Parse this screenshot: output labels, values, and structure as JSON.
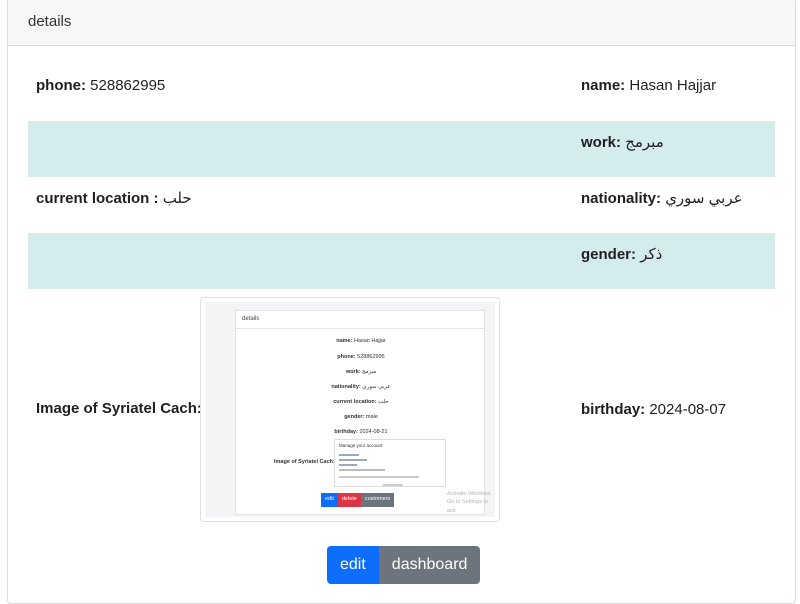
{
  "card": {
    "header": "details"
  },
  "fields": {
    "phone": {
      "label": "phone:",
      "value": "528862995"
    },
    "name": {
      "label": "name:",
      "value": "Hasan Hajjar"
    },
    "work": {
      "label": "work:",
      "value": "مبرمج"
    },
    "current_location": {
      "label": "current location :",
      "value": "حلب"
    },
    "nationality": {
      "label": "nationality:",
      "value": "عربي سوري"
    },
    "gender": {
      "label": "gender:",
      "value": "ذكر"
    },
    "image": {
      "label": "Image of Syriatel Cach:"
    },
    "birthday": {
      "label": "birthday:",
      "value": "2024-08-07"
    }
  },
  "thumbnail": {
    "header": "details",
    "lines": [
      {
        "label": "name:",
        "value": "Hasan Hajjar"
      },
      {
        "label": "phone:",
        "value": "528862995"
      },
      {
        "label": "work:",
        "value": "مبرمج"
      },
      {
        "label": "nationality:",
        "value": "عربي سوري"
      },
      {
        "label": "current location:",
        "value": "حلب"
      },
      {
        "label": "gender:",
        "value": "male"
      },
      {
        "label": "birthday:",
        "value": "2024-08-21"
      }
    ],
    "image_label": "Image of Syriatel Cach:",
    "inner_title": "Manage your account",
    "buttons": {
      "edit": "edit",
      "delete": "delete",
      "customers": "customers"
    },
    "watermark_1": "Activate Windows",
    "watermark_2": "Go to Settings to acti"
  },
  "actions": {
    "edit": "edit",
    "dashboard": "dashboard"
  },
  "colors": {
    "stripe": "#d5ecec",
    "primary": "#0d6efd",
    "secondary": "#6c757d",
    "danger": "#dc3545"
  }
}
